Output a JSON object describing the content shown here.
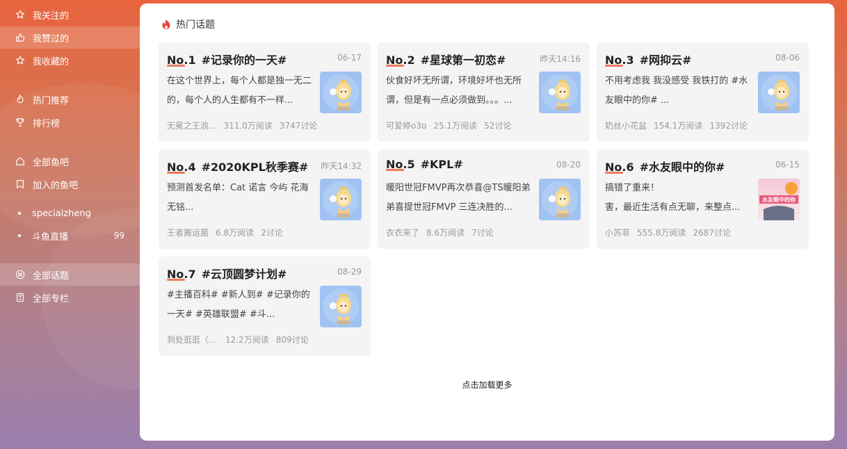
{
  "sidebar": {
    "items": [
      {
        "label": "我关注的",
        "icon": "star-outline-icon"
      },
      {
        "label": "我赞过的",
        "icon": "thumbs-up-icon",
        "active": true
      },
      {
        "label": "我收藏的",
        "icon": "star-icon"
      },
      {
        "label": "热门推荐",
        "icon": "flame-icon"
      },
      {
        "label": "排行榜",
        "icon": "trophy-icon"
      },
      {
        "label": "全部鱼吧",
        "icon": "home-icon"
      },
      {
        "label": "加入的鱼吧",
        "icon": "bookmark-icon"
      },
      {
        "label": "specialzheng"
      },
      {
        "label": "斗鱼直播",
        "badge": "99"
      },
      {
        "label": "全部话题",
        "icon": "hashtag-icon",
        "active": true
      },
      {
        "label": "全部专栏",
        "icon": "column-icon"
      }
    ]
  },
  "main": {
    "title": "热门话题",
    "load_more": "点击加载更多",
    "topics": [
      {
        "rank": "No.1",
        "name": "#记录你的一天#",
        "date": "06-17",
        "desc": "在这个世界上，每个人都是独一无二的，每个人的人生都有不一样...",
        "author": "无冕之王浪...",
        "reads": "311.0万阅读",
        "comments": "3747讨论",
        "thumb": "mascot"
      },
      {
        "rank": "No.2",
        "name": "#星球第一初恋#",
        "date": "昨天14:16",
        "desc": "伙食好坏无所谓，环境好坏也无所谓，但是有一点必须做到。。。...",
        "author": "可爱婷o3o",
        "reads": "25.1万阅读",
        "comments": "52讨论",
        "thumb": "mascot"
      },
      {
        "rank": "No.3",
        "name": "#网抑云#",
        "date": "08-06",
        "desc": "不用考虑我  我没感受  我铁打的  #水友眼中的你#  ...",
        "author": "奶丝小花盆",
        "reads": "154.1万阅读",
        "comments": "1392讨论",
        "thumb": "mascot"
      },
      {
        "rank": "No.4",
        "name": "#2020KPL秋季赛#",
        "date": "昨天14:32",
        "desc": "预测首发名单：Cat 诺言 今屿 花海 无铭...",
        "author": "王者搬运菌",
        "reads": "6.8万阅读",
        "comments": "2讨论",
        "thumb": "mascot"
      },
      {
        "rank": "No.5",
        "name": "#KPL#",
        "date": "08-20",
        "desc": "暖阳世冠FMVP再次恭喜@TS暖阳弟弟喜提世冠FMVP 三连决胜的...",
        "author": "衣衣来了",
        "reads": "8.6万阅读",
        "comments": "7讨论",
        "thumb": "mascot"
      },
      {
        "rank": "No.6",
        "name": "#水友眼中的你#",
        "date": "06-15",
        "desc": "搞错了重来！\n害，最近生活有点无聊，来整点...",
        "author": "小苏菲",
        "reads": "555.8万阅读",
        "comments": "2687讨论",
        "thumb": "poster",
        "thumb_text": "水友眼中的你"
      },
      {
        "rank": "No.7",
        "name": "#云顶圆梦计划#",
        "date": "08-29",
        "desc": " #主播百科#   #新人到#   #记录你的一天#   #英雄联盟#   #斗...",
        "author": "到处逛逛〈〈...",
        "reads": "12.2万阅读",
        "comments": "809讨论",
        "thumb": "mascot"
      }
    ]
  },
  "colors": {
    "accent": "#e8643e",
    "card_bg": "#f4f4f4",
    "thumb_bg": "#9fc2f2"
  }
}
